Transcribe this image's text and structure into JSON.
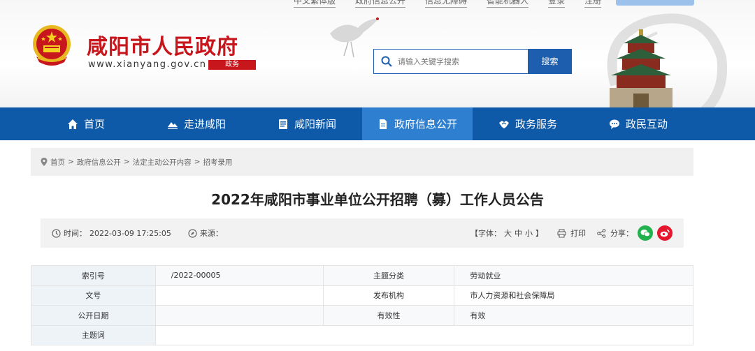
{
  "header": {
    "site_title": "咸阳市人民政府",
    "site_url": "www.xianyang.gov.cn",
    "site_tag": "政务",
    "top_links": [
      "中文繁体版",
      "政府信息公开",
      "信息无障碍",
      "智能机器人",
      "登录",
      "注册"
    ],
    "search": {
      "placeholder": "请输入关键字搜索",
      "button_label": "搜索"
    }
  },
  "nav": {
    "items": [
      {
        "label": "首页",
        "icon": "home-icon",
        "active": false
      },
      {
        "label": "走进咸阳",
        "icon": "landscape-icon",
        "active": false
      },
      {
        "label": "咸阳新闻",
        "icon": "news-icon",
        "active": false
      },
      {
        "label": "政府信息公开",
        "icon": "document-icon",
        "active": true
      },
      {
        "label": "政务服务",
        "icon": "handshake-icon",
        "active": false
      },
      {
        "label": "政民互动",
        "icon": "chat-icon",
        "active": false
      }
    ]
  },
  "breadcrumb": {
    "items": [
      "首页",
      "政府信息公开",
      "法定主动公开内容",
      "招考录用"
    ],
    "separator": ">"
  },
  "article": {
    "title": "2022年咸阳市事业单位公开招聘（募）工作人员公告",
    "time_label": "时间：",
    "time_value": "2022-03-09 17:25:05",
    "source_label": "来源：",
    "source_value": "",
    "font_label": "【字体：",
    "font_sizes": [
      "大",
      "中",
      "小"
    ],
    "font_close": "】",
    "print_label": "打印",
    "share_label": "分享："
  },
  "meta": {
    "rows": [
      {
        "label1": "索引号",
        "value1": "/2022-00005",
        "label2": "主题分类",
        "value2": "劳动就业"
      },
      {
        "label1": "文号",
        "value1": "",
        "label2": "发布机构",
        "value2": "市人力资源和社会保障局"
      },
      {
        "label1": "公开日期",
        "value1": "",
        "label2": "有效性",
        "value2": "有效"
      },
      {
        "label1": "主题词",
        "value1": "",
        "label2": "",
        "value2": ""
      }
    ]
  },
  "colors": {
    "brand_red": "#c8161d",
    "nav_blue": "#0f5aa8",
    "nav_active": "#2e7fd0",
    "search_blue": "#1d5fae"
  }
}
